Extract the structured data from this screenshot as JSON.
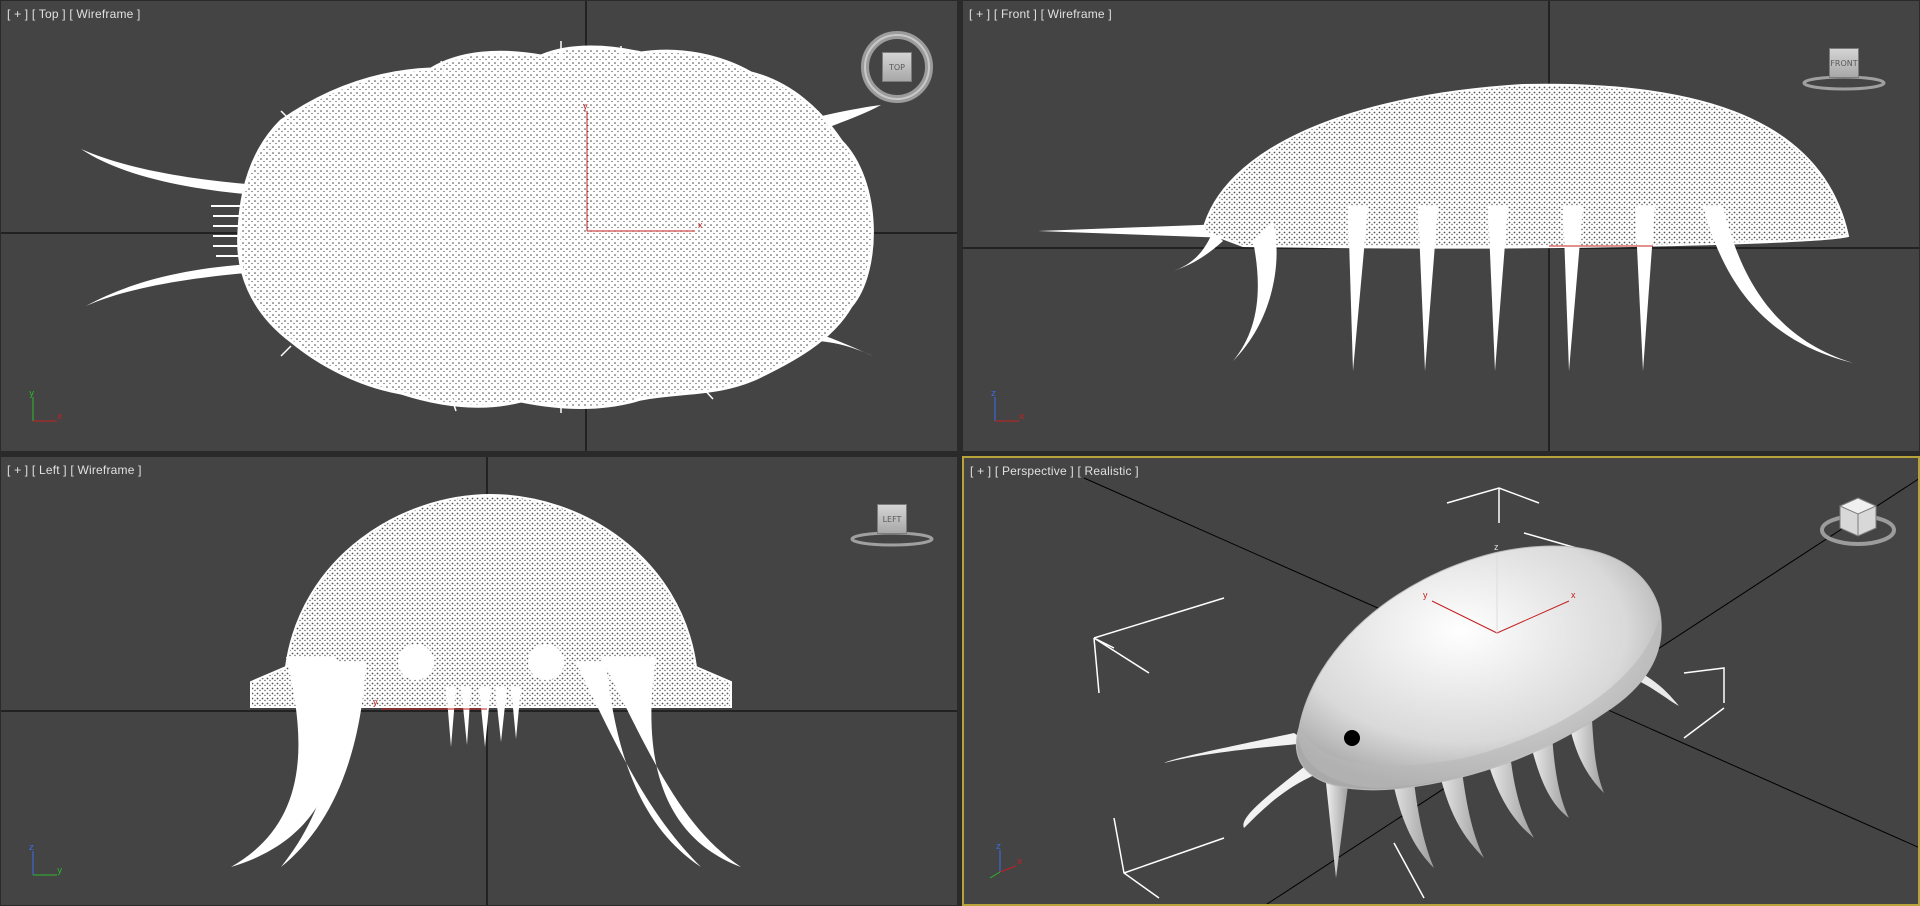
{
  "viewports": {
    "top": {
      "plus": "[ + ]",
      "view": "[ Top ]",
      "shading": "[ Wireframe ]",
      "cube": "TOP",
      "axis_v": "y",
      "axis_h": "x"
    },
    "front": {
      "plus": "[ + ]",
      "view": "[ Front ]",
      "shading": "[ Wireframe ]",
      "cube": "FRONT",
      "axis_v": "z",
      "axis_h": "x"
    },
    "left": {
      "plus": "[ + ]",
      "view": "[ Left ]",
      "shading": "[ Wireframe ]",
      "cube": "LEFT",
      "axis_v": "z",
      "axis_h": "y"
    },
    "persp": {
      "plus": "[ + ]",
      "view": "[ Perspective ]",
      "shading": "[ Realistic ]",
      "cube": "",
      "axis_v": "z",
      "axis_h": "x"
    }
  },
  "gizmo_labels": {
    "x": "x",
    "y": "y",
    "z": "z"
  },
  "colors": {
    "viewport_bg": "#444444",
    "active_border": "#b8a23a",
    "gizmo": "#c42020",
    "mesh": "#ffffff",
    "grid_line": "#000000"
  }
}
